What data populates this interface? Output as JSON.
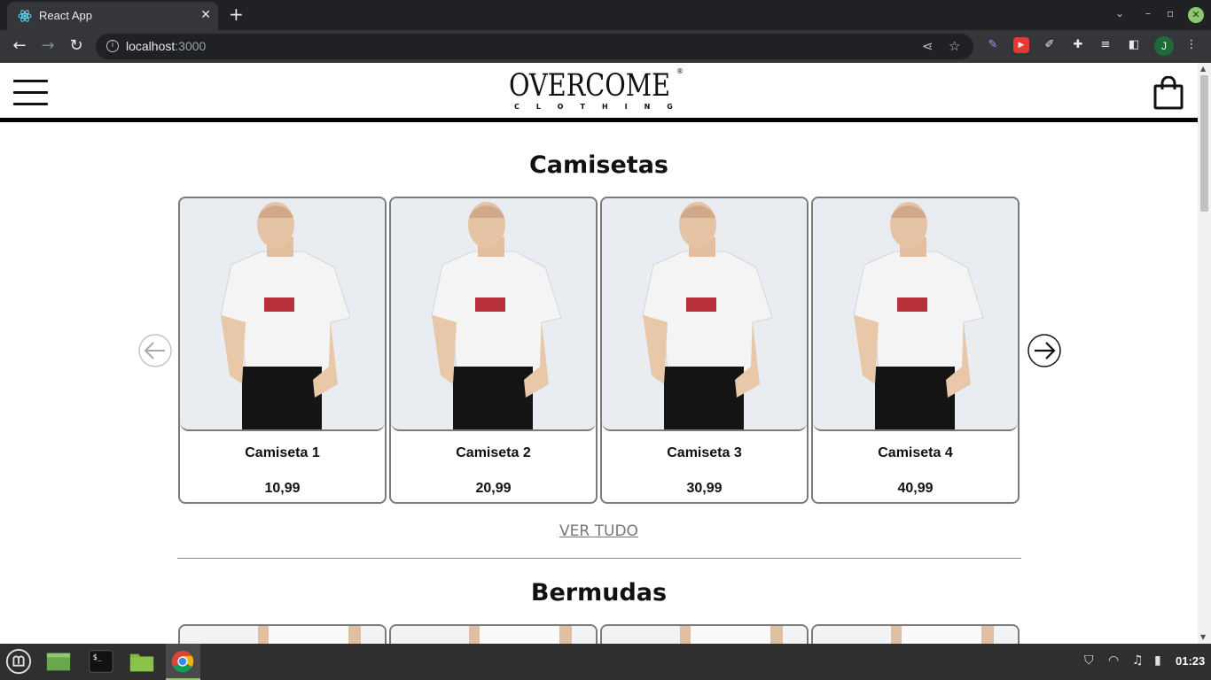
{
  "browser": {
    "tab_title": "React App",
    "tab_close": "✕",
    "new_tab": "+",
    "url_host": "localhost",
    "url_port": ":3000",
    "profile_initial": "J"
  },
  "site": {
    "logo_main": "OVERCOME",
    "logo_sub": "CLOTHING",
    "logo_reg": "®"
  },
  "sections": [
    {
      "title": "Camisetas",
      "products": [
        {
          "name": "Camiseta 1",
          "price": "10,99"
        },
        {
          "name": "Camiseta 2",
          "price": "20,99"
        },
        {
          "name": "Camiseta 3",
          "price": "30,99"
        },
        {
          "name": "Camiseta 4",
          "price": "40,99"
        }
      ],
      "see_all": "VER TUDO"
    },
    {
      "title": "Bermudas"
    }
  ],
  "taskbar": {
    "clock": "01:23"
  },
  "colors": {
    "card_border": "#7b7b7b",
    "image_bg": "#e9ecf1",
    "accent": "#8fc66f"
  },
  "icons": {
    "menu": "hamburger-icon",
    "bag": "shopping-bag-icon",
    "prev": "arrow-left-icon",
    "next": "arrow-right-icon"
  }
}
